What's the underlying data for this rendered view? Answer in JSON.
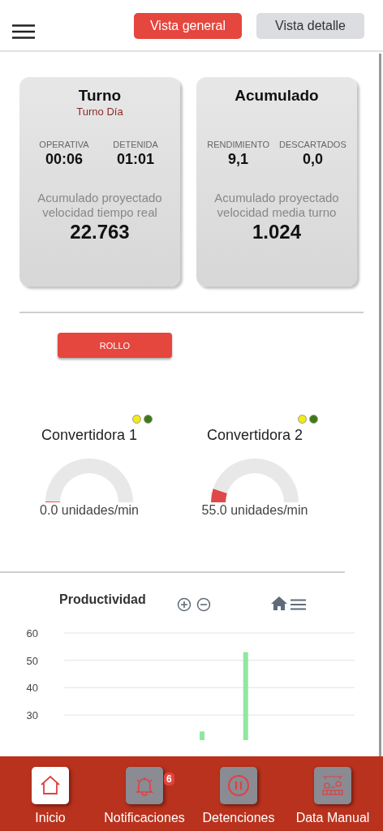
{
  "header": {
    "tabs": [
      {
        "label": "Vista general",
        "selected": true
      },
      {
        "label": "Vista detalle",
        "selected": false
      }
    ]
  },
  "cards": [
    {
      "title": "Turno",
      "subtitle": "Turno Día",
      "stats": [
        {
          "label": "OPERATIVA",
          "value": "00:06"
        },
        {
          "label": "DETENIDA",
          "value": "01:01"
        }
      ],
      "caption": "Acumulado proyectado velocidad tiempo real",
      "total": "22.763"
    },
    {
      "title": "Acumulado",
      "stats": [
        {
          "label": "RENDIMIENTO",
          "value": "9,1"
        },
        {
          "label": "DESCARTADOS",
          "value": "0,0"
        }
      ],
      "caption": "Acumulado proyectado velocidad media turno",
      "total": "1.024"
    }
  ],
  "roll_button": "ROLLO",
  "machines": [
    {
      "name": "Convertidora 1",
      "indicators": [
        {
          "color": "#f2ea17"
        },
        {
          "color": "#3d7a14"
        }
      ],
      "reading": "0.0 unidades/min"
    },
    {
      "name": "Convertidora 2",
      "indicators": [
        {
          "color": "#f2ea17"
        },
        {
          "color": "#3d7a14"
        }
      ],
      "reading": "55.0 unidades/min"
    }
  ],
  "chart": {
    "chart_data": {
      "type": "bar",
      "title": "Productividad",
      "ylim": [
        0,
        60
      ],
      "yticks": [
        30,
        40,
        50,
        60
      ],
      "grid": true,
      "values": [
        null,
        null,
        null,
        null,
        null,
        null,
        null,
        null,
        null,
        24,
        null,
        null,
        53,
        null,
        null,
        null,
        null,
        null,
        null,
        null
      ]
    }
  },
  "nav": [
    {
      "label": "Inicio",
      "selected": true,
      "kind": "home"
    },
    {
      "label": "Notificaciones",
      "selected": false,
      "kind": "bell",
      "badge": "6"
    },
    {
      "label": "Detenciones",
      "selected": false,
      "kind": "pause"
    },
    {
      "label": "Data Manual",
      "selected": false,
      "kind": "factory"
    }
  ]
}
